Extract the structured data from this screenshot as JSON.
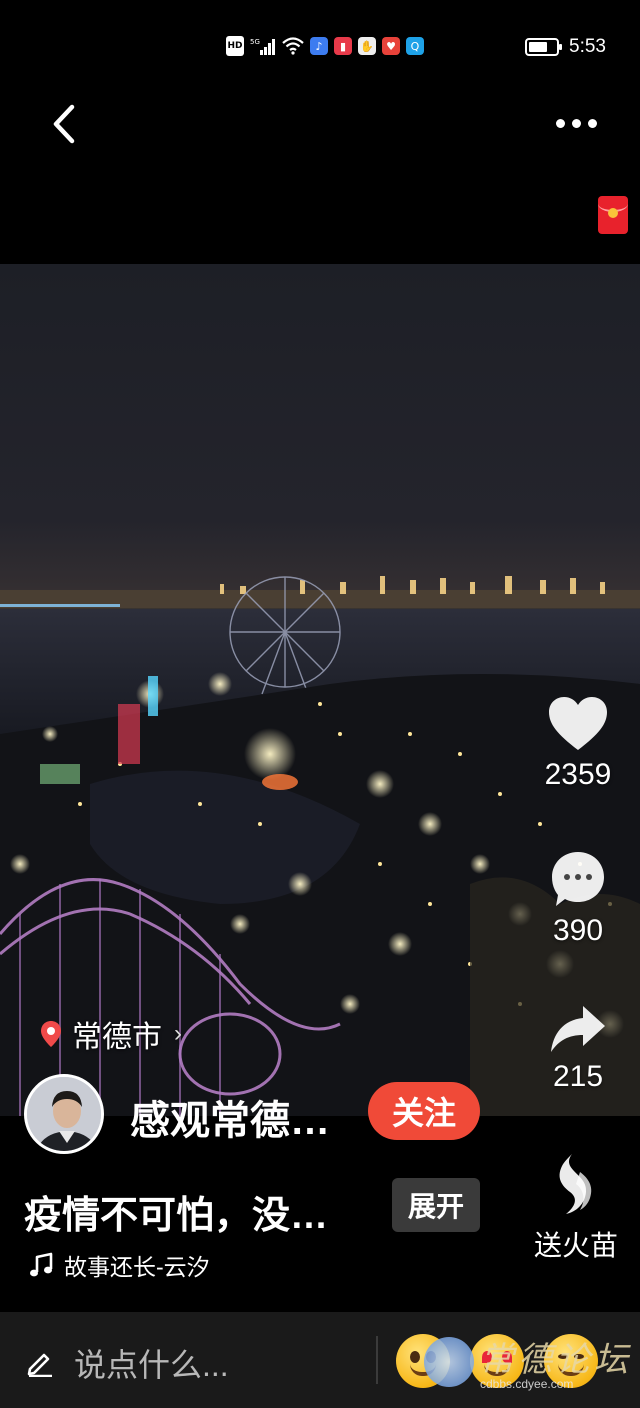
{
  "status_bar": {
    "network_badge": "HD",
    "signal_label": "5G",
    "time": "5:53",
    "battery_level": 0.7
  },
  "video": {
    "location": "常德市",
    "likes": "2359",
    "comments": "390",
    "shares": "215",
    "gift_label": "送火苗"
  },
  "author": {
    "name": "感观常德…",
    "follow_label": "关注"
  },
  "post": {
    "caption": "疫情不可怕，没…",
    "expand_label": "展开",
    "music": "故事还长-云汐"
  },
  "bottom_bar": {
    "comment_placeholder": "说点什么..."
  },
  "watermark": {
    "title": "常德论坛",
    "url": "cdbbs.cdyee.com"
  },
  "colors": {
    "follow": "#f04a38",
    "background": "#000000",
    "bottom_bar": "#1a1a1a"
  }
}
